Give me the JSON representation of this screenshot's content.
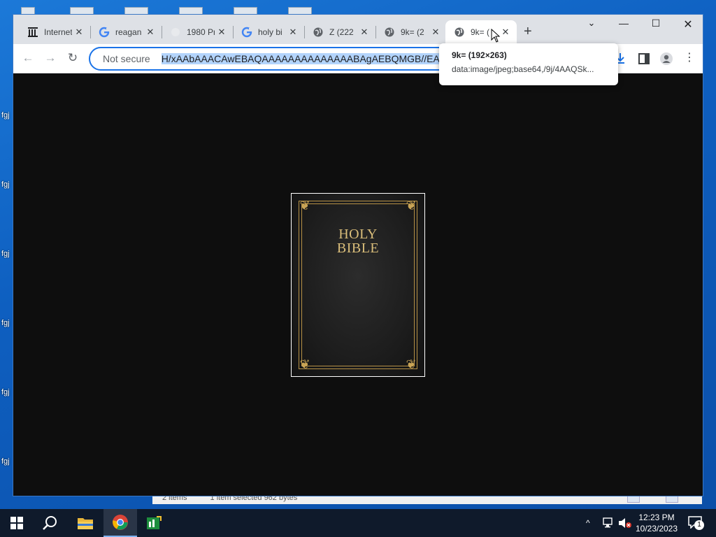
{
  "desktop": {
    "labels": [
      "fgj",
      "fgj",
      "fgj",
      "fgj",
      "fgj",
      "fgj"
    ]
  },
  "explorer_status": {
    "items": "2 items",
    "selected": "1 item selected  962 bytes"
  },
  "browser": {
    "tabs": [
      {
        "title": "Internet",
        "icon": "archive-icon"
      },
      {
        "title": "reagan",
        "icon": "google-icon"
      },
      {
        "title": "1980 Pr",
        "icon": "blank-page-icon"
      },
      {
        "title": "holy bi",
        "icon": "google-icon"
      },
      {
        "title": "Z (222",
        "icon": "globe-icon"
      },
      {
        "title": "9k= (2",
        "icon": "globe-icon"
      },
      {
        "title": "9k= (",
        "icon": "globe-icon",
        "active": true
      }
    ],
    "omnibox": {
      "security": "Not secure",
      "url": "H/xAAbAAACAwEBAQAAAAAAAAAAAAAABAgAEBQMGB//EAFM"
    },
    "tooltip": {
      "title": "9k= (192×263)",
      "url": "data:image/jpeg;base64,/9j/4AAQSk..."
    },
    "image": {
      "cover_text_line1": "HOLY",
      "cover_text_line2": "BIBLE"
    }
  },
  "taskbar": {
    "time": "12:23 PM",
    "date": "10/23/2023",
    "notification_count": "1"
  },
  "colors": {
    "accent": "#1a73e8",
    "gold": "#c9a456",
    "taskbar": "#0f1a2b"
  }
}
